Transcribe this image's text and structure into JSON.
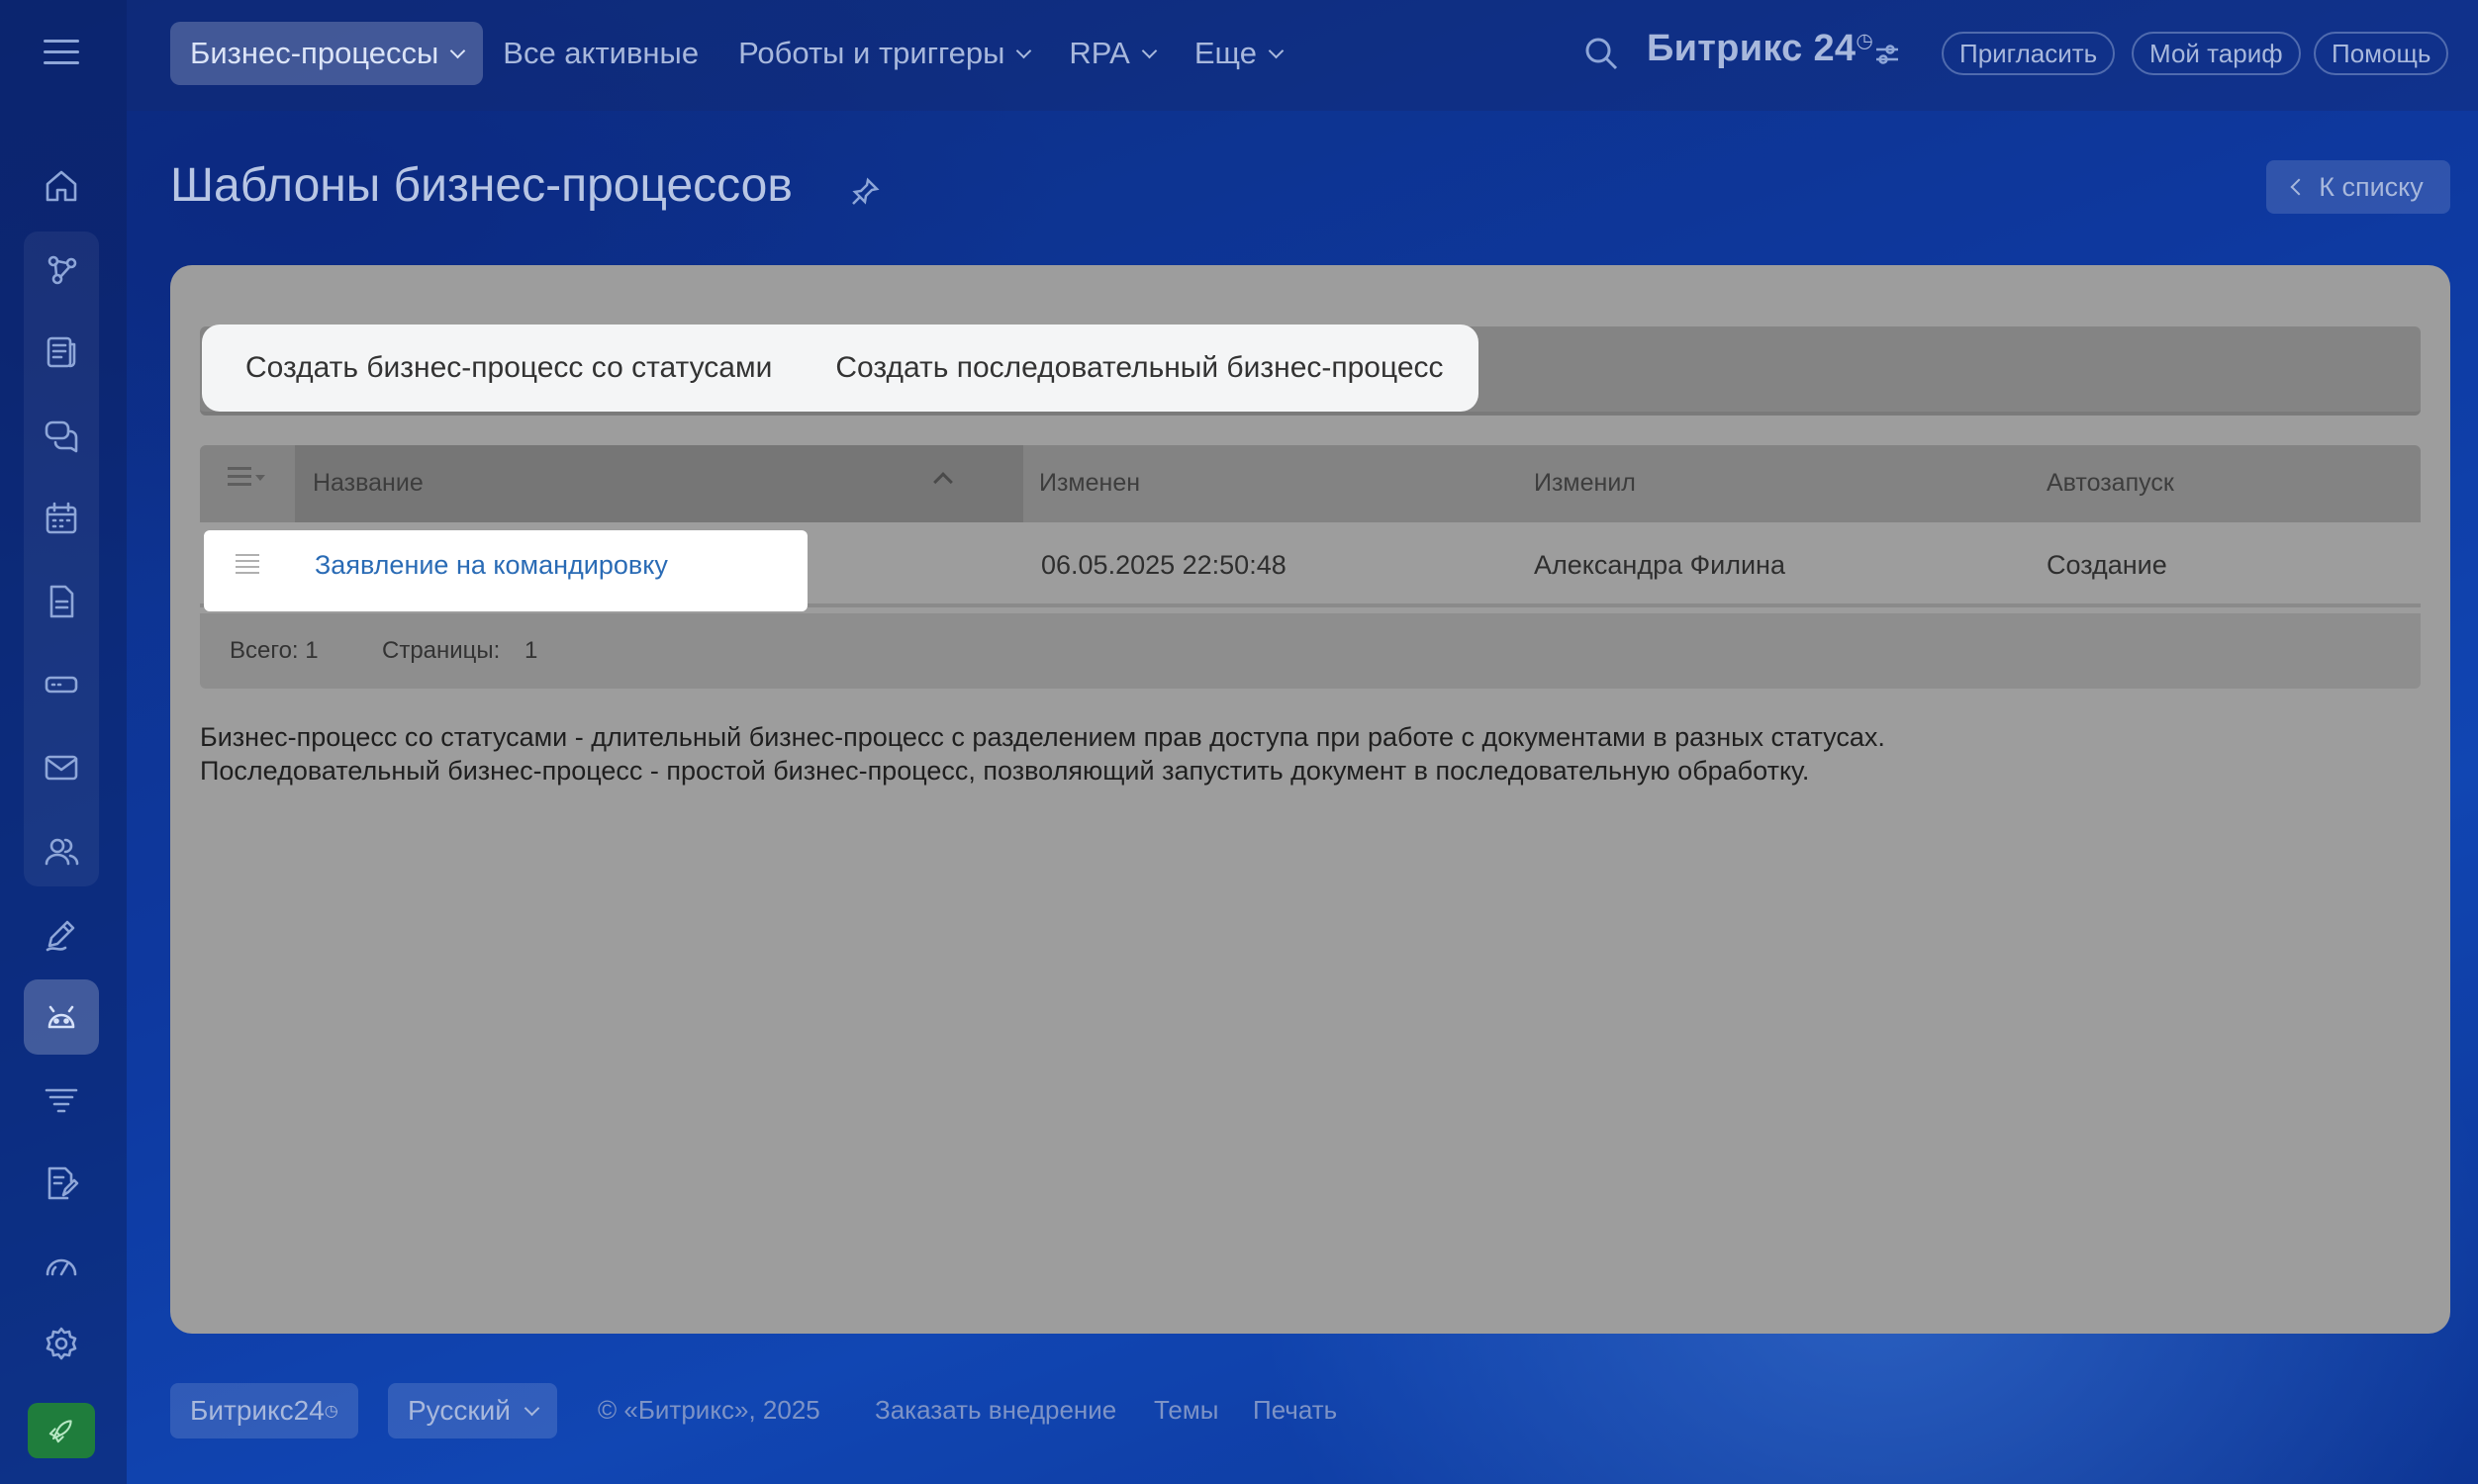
{
  "topbar": {
    "nav": [
      {
        "label": "Бизнес-процессы",
        "dropdown": true,
        "active": true
      },
      {
        "label": "Все активные",
        "dropdown": false,
        "active": false
      },
      {
        "label": "Роботы и триггеры",
        "dropdown": true,
        "active": false
      },
      {
        "label": "RPA",
        "dropdown": true,
        "active": false
      },
      {
        "label": "Еще",
        "dropdown": true,
        "active": false
      }
    ],
    "brand": "Битрикс 24",
    "invite_label": "Пригласить",
    "tariff_label": "Мой тариф",
    "help_label": "Помощь"
  },
  "header": {
    "title": "Шаблоны бизнес-процессов",
    "back_label": "К списку"
  },
  "toolbar": {
    "create_status_label": "Создать бизнес-процесс со статусами",
    "create_sequential_label": "Создать последовательный бизнес-процесс"
  },
  "table": {
    "columns": [
      "Название",
      "Изменен",
      "Изменил",
      "Автозапуск"
    ],
    "rows": [
      {
        "name": "Заявление на командировку",
        "modified": "06.05.2025 22:50:48",
        "modified_by": "Александра Филина",
        "autorun": "Создание"
      }
    ],
    "total_label": "Всего: 1",
    "pages_label": "Страницы:",
    "pages_value": "1"
  },
  "description": {
    "line1": "Бизнес-процесс со статусами - длительный бизнес-процесс с разделением прав доступа при работе с документами в разных статусах.",
    "line2": "Последовательный бизнес-процесс - простой бизнес-процесс, позволяющий запустить документ в последовательную обработку."
  },
  "footer": {
    "brand": "Битрикс24",
    "language": "Русский",
    "copyright": "© «Битрикс», 2025",
    "order_label": "Заказать внедрение",
    "themes_label": "Темы",
    "print_label": "Печать"
  },
  "rail_icons": [
    "menu-icon",
    "home-icon",
    "crm-icon",
    "feed-icon",
    "chat-icon",
    "calendar-icon",
    "document-icon",
    "drive-icon",
    "mail-icon",
    "contacts-icon",
    "sign-icon",
    "automation-icon",
    "filter-icon",
    "edit-doc-icon",
    "analytics-icon",
    "settings-icon",
    "rocket-icon"
  ],
  "colors": {
    "accent": "#2a6bb5",
    "rail_active_green": "#1f7d3c"
  }
}
